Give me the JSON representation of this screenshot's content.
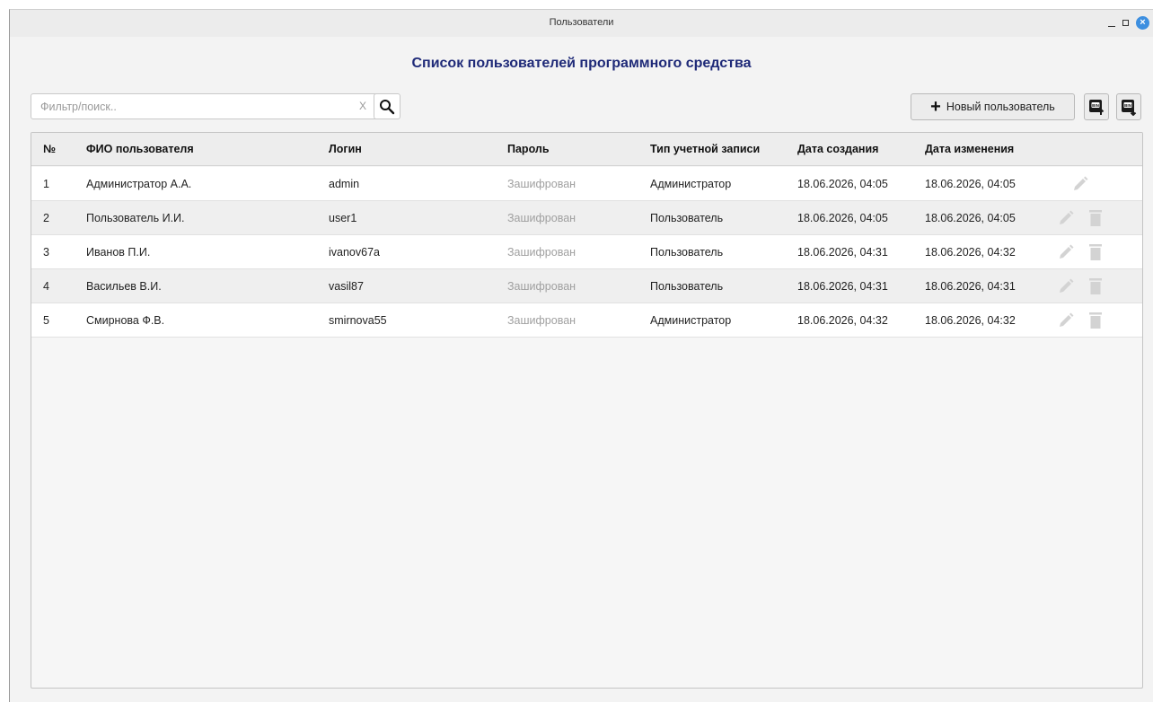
{
  "window": {
    "title": "Пользователи"
  },
  "page_title": "Список пользователей программного средства",
  "search": {
    "placeholder": "Фильтр/поиск..",
    "value": "",
    "clear_label": "X"
  },
  "toolbar": {
    "new_user_label": "Новый пользователь"
  },
  "table": {
    "headers": {
      "num": "№",
      "fio": "ФИО пользователя",
      "login": "Логин",
      "password": "Пароль",
      "type": "Тип учетной записи",
      "created": "Дата создания",
      "modified": "Дата изменения"
    },
    "rows": [
      {
        "num": "1",
        "fio": "Администратор А.А.",
        "login": "admin",
        "password": "Зашифрован",
        "type": "Администратор",
        "created": "18.06.2026, 04:05",
        "modified": "18.06.2026, 04:05"
      },
      {
        "num": "2",
        "fio": "Пользователь И.И.",
        "login": "user1",
        "password": "Зашифрован",
        "type": "Пользователь",
        "created": "18.06.2026, 04:05",
        "modified": "18.06.2026, 04:05"
      },
      {
        "num": "3",
        "fio": "Иванов П.И.",
        "login": "ivanov67a",
        "password": "Зашифрован",
        "type": "Пользователь",
        "created": "18.06.2026, 04:31",
        "modified": "18.06.2026, 04:32"
      },
      {
        "num": "4",
        "fio": "Васильев В.И.",
        "login": "vasil87",
        "password": "Зашифрован",
        "type": "Пользователь",
        "created": "18.06.2026, 04:31",
        "modified": "18.06.2026, 04:31"
      },
      {
        "num": "5",
        "fio": "Смирнова Ф.В.",
        "login": "smirnova55",
        "password": "Зашифрован",
        "type": "Администратор",
        "created": "18.06.2026, 04:32",
        "modified": "18.06.2026, 04:32"
      }
    ]
  },
  "colors": {
    "title_color": "#1f2a78",
    "close_button": "#3d8fe0",
    "muted_icon": "#d3d3d3"
  },
  "icons": {
    "search": "search-icon",
    "clear": "clear-icon",
    "add": "plus-icon",
    "bin_import": "bin-import-icon",
    "bin_export": "bin-export-icon",
    "edit": "pencil-icon",
    "delete": "trash-icon"
  }
}
